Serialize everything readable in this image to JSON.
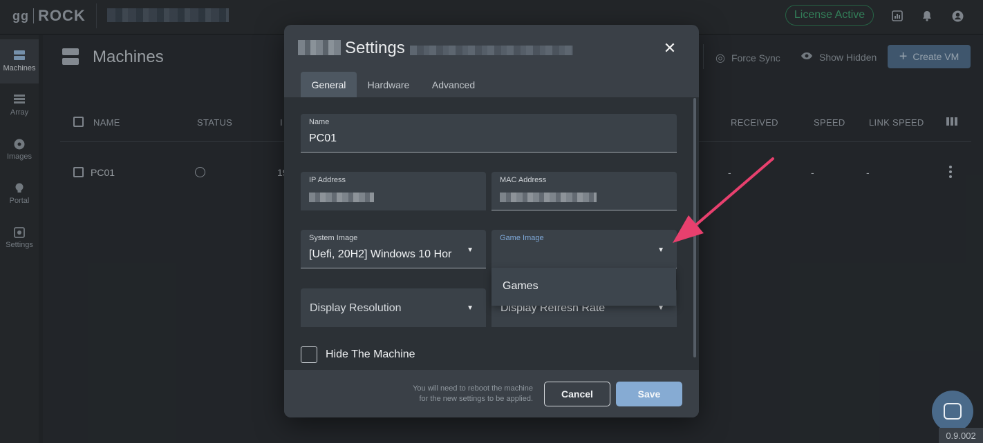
{
  "app": {
    "logo_prefix": "gg",
    "logo_name": "ROCK",
    "license_label": "License Active"
  },
  "sidebar": {
    "items": [
      {
        "label": "Machines",
        "icon": "server-icon"
      },
      {
        "label": "Array",
        "icon": "array-icon"
      },
      {
        "label": "Images",
        "icon": "disc-icon"
      },
      {
        "label": "Portal",
        "icon": "bulb-icon"
      },
      {
        "label": "Settings",
        "icon": "settings-icon"
      }
    ]
  },
  "header": {
    "title": "Machines",
    "force_sync_label": "Force Sync",
    "show_hidden_label": "Show Hidden",
    "create_vm_label": "Create VM"
  },
  "table": {
    "columns": [
      "NAME",
      "STATUS",
      "I",
      "RECEIVED",
      "SPEED",
      "LINK SPEED"
    ],
    "rows": [
      {
        "name": "PC01",
        "ip_partial": "19",
        "received": "-",
        "speed": "-",
        "link_speed": "-"
      }
    ]
  },
  "dialog": {
    "title": "Settings",
    "tabs": [
      "General",
      "Hardware",
      "Advanced"
    ],
    "active_tab": "General",
    "fields": {
      "name": {
        "label": "Name",
        "value": "PC01"
      },
      "ip": {
        "label": "IP Address"
      },
      "mac": {
        "label": "MAC Address"
      },
      "system_image": {
        "label": "System Image",
        "value": "[Uefi, 20H2] Windows 10 Hor"
      },
      "game_image": {
        "label": "Game Image"
      },
      "display_resolution": {
        "placeholder": "Display Resolution"
      },
      "display_refresh_rate": {
        "placeholder": "Display Refresh Rate"
      }
    },
    "dropdown_options": [
      "Games"
    ],
    "hide_machine_label": "Hide The Machine",
    "note_line1": "You will need to reboot the machine",
    "note_line2": "for the new settings to be applied.",
    "cancel_label": "Cancel",
    "save_label": "Save"
  },
  "version": "0.9.002",
  "colors": {
    "accent": "#86abd3",
    "license": "#3e9a6c",
    "arrow": "#e8406e"
  }
}
